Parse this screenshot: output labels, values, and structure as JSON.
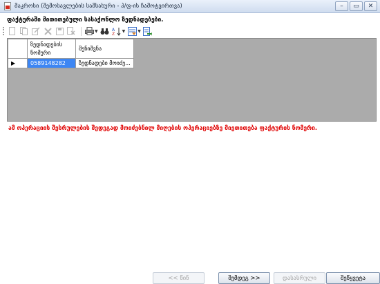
{
  "window": {
    "title": "მაკროსი (შემოსავლების სამსახური - პ/ფ-ის ჩამოტვირთვა)",
    "minimize_glyph": "–",
    "restore_glyph": "▭",
    "close_glyph": "✕"
  },
  "instruction": "ფაქტურაში მითითებული სასაქონლო ზედნადებები.",
  "grid": {
    "columns": [
      "ზედნადების ნომერი",
      "შენიშვნა"
    ],
    "rows": [
      {
        "indicator": "▶",
        "number": "0589148282",
        "note": "ზედნადები მოიძე..."
      }
    ]
  },
  "message": "ამ ოპერაციის შესრულების შედეგად მოიძებნილ მიღების ოპერაციებზე მიეთითება ფაქტურის ნომერი.",
  "buttons": {
    "back": "<< წინ",
    "next": "შემდეგ >>",
    "finish": "დასასრული",
    "cancel": "შეწყვეტა"
  }
}
